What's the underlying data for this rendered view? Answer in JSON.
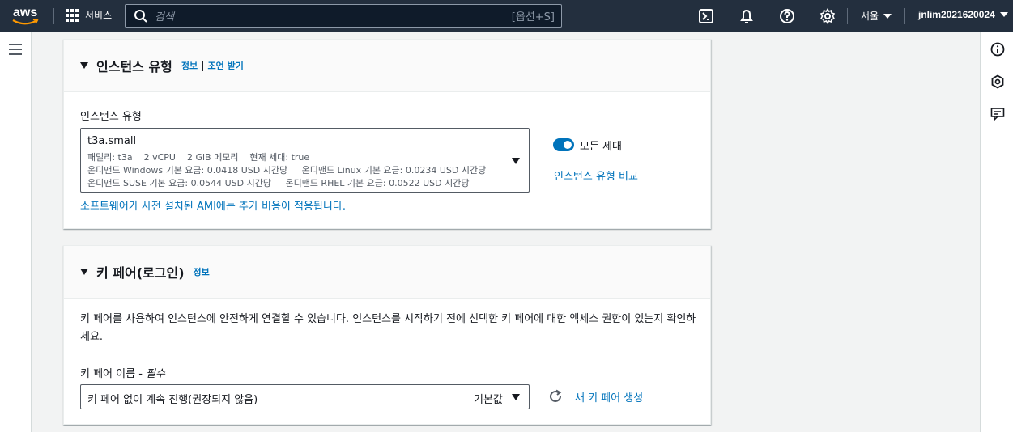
{
  "topnav": {
    "logo_text": "aws",
    "services_label": "서비스",
    "search_placeholder": "검색",
    "search_shortcut": "[옵션+S]",
    "region": "서울",
    "user": "jnlim2021620024"
  },
  "instance_type_panel": {
    "title": "인스턴스 유형",
    "info_link": "정보",
    "separator": "|",
    "advice_link": "조언 받기",
    "field_label": "인스턴스 유형",
    "selected_type": "t3a.small",
    "detail_line1": "패밀리: t3a    2 vCPU    2 GiB 메모리    현재 세대: true",
    "detail_line2": "온디맨드 Windows 기본 요금: 0.0418 USD 시간당     온디맨드 Linux 기본 요금: 0.0234 USD 시간당",
    "detail_line3": "온디맨드 SUSE 기본 요금: 0.0544 USD 시간당     온디맨드 RHEL 기본 요금: 0.0522 USD 시간당",
    "toggle_label": "모든 세대",
    "toggle_on": true,
    "compare_link": "인스턴스 유형 비교",
    "ami_note": "소프트웨어가 사전 설치된 AMI에는 추가 비용이 적용됩니다."
  },
  "key_pair_panel": {
    "title": "키 페어(로그인)",
    "info_link": "정보",
    "description": "키 페어를 사용하여 인스턴스에 안전하게 연결할 수 있습니다. 인스턴스를 시작하기 전에 선택한 키 페어에 대한 액세스 권한이 있는지 확인하세요.",
    "field_label": "키 페어 이름 - ",
    "field_required": "필수",
    "selected_value": "키 페어 없이 계속 진행(권장되지 않음)",
    "default_badge": "기본값",
    "create_link": "새 키 페어 생성"
  },
  "colors": {
    "nav_bg": "#232f3e",
    "link": "#0073bb",
    "toggle": "#0073bb"
  }
}
